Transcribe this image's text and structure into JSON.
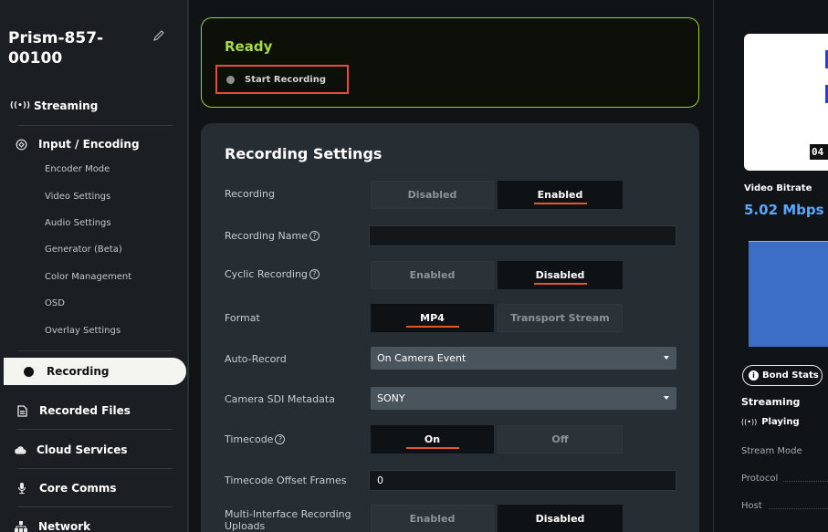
{
  "sidebar": {
    "device_title": "Prism-857-00100",
    "items": {
      "streaming": "Streaming",
      "input_encoding": "Input / Encoding",
      "recording": "Recording",
      "recorded_files": "Recorded Files",
      "cloud_services": "Cloud Services",
      "core_comms": "Core Comms",
      "network": "Network"
    },
    "sub_items": [
      "Encoder Mode",
      "Video Settings",
      "Audio Settings",
      "Generator (Beta)",
      "Color Management",
      "OSD",
      "Overlay Settings"
    ]
  },
  "status": {
    "state": "Ready",
    "start_recording_label": "Start Recording"
  },
  "settings": {
    "title": "Recording Settings",
    "recording": {
      "label": "Recording",
      "options": [
        "Disabled",
        "Enabled"
      ],
      "selected": "Enabled"
    },
    "recording_name": {
      "label": "Recording Name",
      "value": ""
    },
    "cyclic_recording": {
      "label": "Cyclic Recording",
      "options": [
        "Enabled",
        "Disabled"
      ],
      "selected": "Disabled"
    },
    "format": {
      "label": "Format",
      "options": [
        "MP4",
        "Transport Stream"
      ],
      "selected": "MP4"
    },
    "auto_record": {
      "label": "Auto-Record",
      "value": "On Camera Event"
    },
    "camera_sdi_metadata": {
      "label": "Camera SDI Metadata",
      "value": "SONY"
    },
    "timecode": {
      "label": "Timecode",
      "options": [
        "On",
        "Off"
      ],
      "selected": "On"
    },
    "timecode_offset_frames": {
      "label": "Timecode Offset Frames",
      "value": "0"
    },
    "multi_interface": {
      "label": "Multi-Interface Recording Uploads",
      "options": [
        "Enabled",
        "Disabled"
      ],
      "selected": "Disabled"
    }
  },
  "right_panel": {
    "preview_timecode": "04",
    "video_bitrate_label": "Video Bitrate",
    "video_bitrate_value": "5.02 Mbps",
    "bond_stats_label": "Bond Stats",
    "streaming_label": "Streaming",
    "streaming_state": "Playing",
    "stream_mode_label": "Stream Mode",
    "protocol_label": "Protocol",
    "host_label": "Host"
  },
  "colors": {
    "accent_green": "#a8d94a",
    "accent_orange": "#e8552a",
    "bitrate_blue": "#5aa7ff",
    "highlight_red": "#e84d33"
  }
}
